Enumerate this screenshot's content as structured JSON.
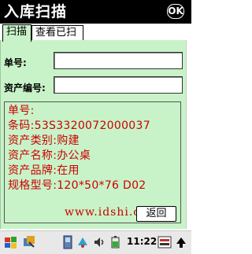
{
  "window": {
    "title": "入库扫描",
    "close_label": "OK"
  },
  "tabs": [
    {
      "label": "扫描",
      "active": true
    },
    {
      "label": "查看已扫",
      "active": false
    }
  ],
  "form": {
    "order_label": "单号:",
    "order_value": "",
    "asset_label": "资产编号:",
    "asset_value": ""
  },
  "info": {
    "lines": [
      "单号:",
      "条码:53S3320072000037",
      "资产类别:购建",
      "资产名称:办公桌",
      "资产品牌:在用",
      "规格型号:120*50*76 D02"
    ],
    "color": "#cc0000"
  },
  "watermark": "www.idshi.com",
  "back_button": "返回",
  "taskbar": {
    "time": "11:22"
  },
  "colors": {
    "panel_bg": "#c8f3c8",
    "titlebar_bg": "#000000"
  }
}
